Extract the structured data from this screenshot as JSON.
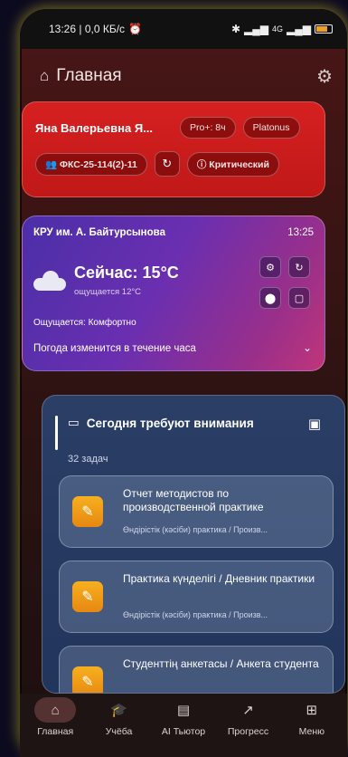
{
  "status_bar": {
    "time": "13:26 | 0,0 КБ/с",
    "signal": "4G"
  },
  "header": {
    "title": "Главная"
  },
  "profile": {
    "name": "Яна Валерьевна Я...",
    "pro_badge": "Pro+: 8ч",
    "platonus_label": "Platonus",
    "group": "ФКС-25-114(2)-11",
    "status_label": "Критический"
  },
  "weather": {
    "location": "КРУ им. А. Байтурсынова",
    "time": "13:25",
    "current": "Сейчас: 15°C",
    "feels_like_short": "ощущается 12°C",
    "feels_like_comfort": "Ощущается: Комфортно",
    "forecast_note": "Погода изменится в течение часа"
  },
  "attention": {
    "title": "Сегодня требуют внимания",
    "count": "32 задач",
    "tasks": [
      {
        "title": "Отчет методистов по производственной практике",
        "subtitle": "Өндірістік (кәсіби) практика / Произв..."
      },
      {
        "title": "Практика күнделігі / Дневник практики",
        "subtitle": "Өндірістік (кәсіби) практика / Произв..."
      },
      {
        "title": "Студенттің анкетасы / Анкета студента",
        "subtitle": ""
      }
    ]
  },
  "nav": {
    "items": [
      {
        "label": "Главная",
        "icon": "home-icon"
      },
      {
        "label": "Учёба",
        "icon": "graduation-cap-icon"
      },
      {
        "label": "AI Тьютор",
        "icon": "chat-icon"
      },
      {
        "label": "Прогресс",
        "icon": "trend-icon"
      },
      {
        "label": "Меню",
        "icon": "grid-icon"
      }
    ]
  }
}
